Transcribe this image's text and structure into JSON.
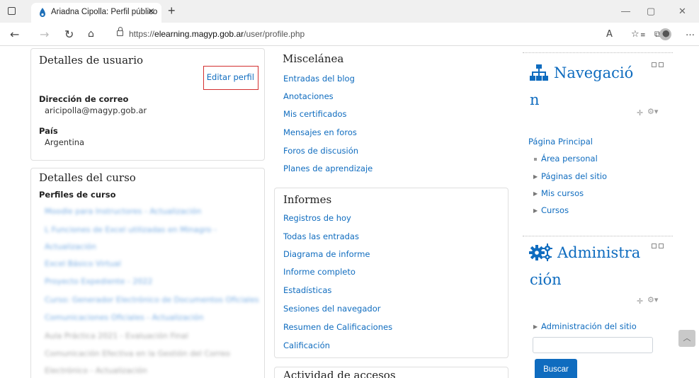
{
  "browser": {
    "tab_title": "Ariadna Cipolla: Perfil público",
    "tab_close": "×",
    "new_tab": "+",
    "url_prefix": "https://",
    "url_domain": "elearning.magyp.gob.ar",
    "url_path": "/user/profile.php",
    "win_minimize": "—",
    "win_restore": "▢",
    "win_close": "✕"
  },
  "user_details": {
    "title": "Detalles de usuario",
    "edit_label": "Editar perfil",
    "email_label": "Dirección de correo",
    "email_value": "aricipolla@magyp.gob.ar",
    "country_label": "País",
    "country_value": "Argentina"
  },
  "course_details": {
    "title": "Detalles del curso",
    "profiles_label": "Perfiles de curso",
    "courses": [
      "Moodle para Instructores - Actualización",
      "L Funciones de Excel utilizadas en Minagro -",
      "Actualización",
      "Excel Básico Virtual",
      "Proyecto Expediente - 2022",
      "Curso: Generador Electrónico de Documentos Oficiales",
      "Comunicaciones Oficiales - Actualización",
      "Aula Práctica 2021 - Evaluación Final",
      "Comunicación Efectiva en la Gestión del Correo",
      "Electrónico - Actualización"
    ]
  },
  "misc": {
    "title": "Miscelánea",
    "links": [
      "Entradas del blog",
      "Anotaciones",
      "Mis certificados",
      "Mensajes en foros",
      "Foros de discusión",
      "Planes de aprendizaje"
    ]
  },
  "reports": {
    "title": "Informes",
    "links": [
      "Registros de hoy",
      "Todas las entradas",
      "Diagrama de informe",
      "Informe completo",
      "Estadísticas",
      "Sesiones del navegador",
      "Resumen de Calificaciones",
      "Calificación"
    ]
  },
  "access": {
    "title": "Actividad de accesos"
  },
  "navigation": {
    "title_line1": "Navegació",
    "title_line2": "n",
    "home": "Página Principal",
    "items": [
      "Área personal",
      "Páginas del sitio",
      "Mis cursos",
      "Cursos"
    ]
  },
  "admin": {
    "title_line1": "Administra",
    "title_line2": "ción",
    "site_admin": "Administración del sitio",
    "search_button": "Buscar"
  }
}
